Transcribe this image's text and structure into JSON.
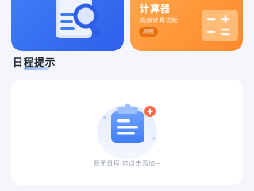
{
  "cards": {
    "left": {
      "icon": "document-search-icon",
      "color": "#3f7ef7"
    },
    "right": {
      "title": "计算器",
      "subtitle": "高效计算功能",
      "tag": "高效",
      "icon": "calculator-icon",
      "color": "#ff9a3c"
    }
  },
  "schedule": {
    "title": "日程提示",
    "empty_text": "暂无日程 可点击添加~",
    "empty_icon": "clipboard-add-icon"
  }
}
